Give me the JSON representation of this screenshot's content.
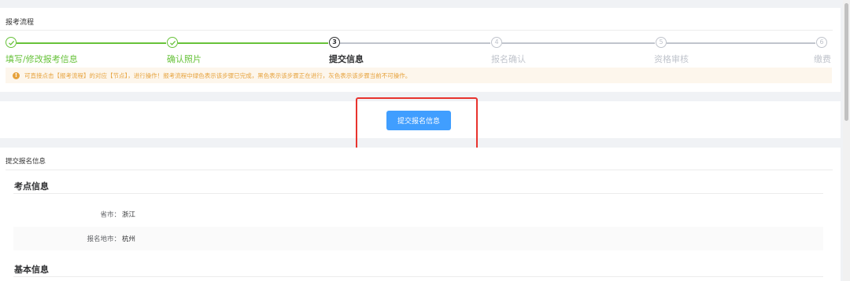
{
  "process": {
    "title": "报考流程",
    "steps": [
      {
        "num": "1",
        "label": "填写/修改报考信息",
        "status": "done"
      },
      {
        "num": "2",
        "label": "确认照片",
        "status": "done"
      },
      {
        "num": "3",
        "label": "提交信息",
        "status": "active"
      },
      {
        "num": "4",
        "label": "报名确认",
        "status": "todo"
      },
      {
        "num": "5",
        "label": "资格审核",
        "status": "todo"
      },
      {
        "num": "6",
        "label": "缴费",
        "status": "todo"
      }
    ],
    "notice_icon": "!",
    "notice": "可直接点击【报考流程】的对应【节点】，进行操作！报考流程中绿色表示该步骤已完成，黑色表示该步骤正在进行，灰色表示该步骤当前不可操作。"
  },
  "submit": {
    "button_label": "提交报名信息"
  },
  "info": {
    "title": "提交报名信息",
    "exam_section": "考点信息",
    "rows": [
      {
        "label": "省市：",
        "value": "浙江"
      },
      {
        "label": "报名地市：",
        "value": "杭州"
      }
    ],
    "basic_section": "基本信息"
  },
  "colors": {
    "done": "#67c23a",
    "active": "#303133",
    "todo": "#c0c4cc",
    "primary": "#409eff",
    "warning": "#e6a23c",
    "highlight": "#e8332e"
  }
}
